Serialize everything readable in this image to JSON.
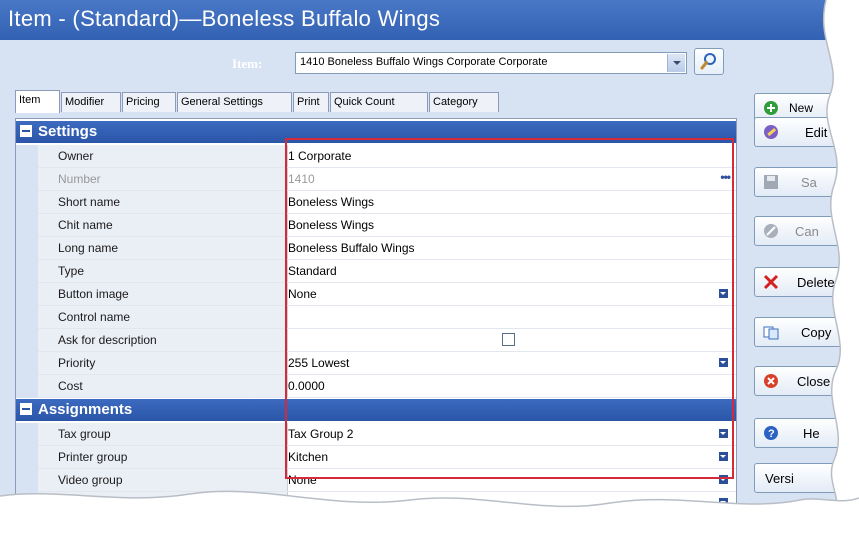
{
  "window": {
    "title": "Item - (Standard)—Boneless Buffalo Wings"
  },
  "item_selector": {
    "label": "Item:",
    "value": "1410 Boneless Buffalo Wings Corporate Corporate"
  },
  "tabs": [
    {
      "label": "Item"
    },
    {
      "label": "Modifier"
    },
    {
      "label": "Pricing"
    },
    {
      "label": "General Settings"
    },
    {
      "label": "Print"
    },
    {
      "label": "Quick Count"
    },
    {
      "label": "Category"
    }
  ],
  "sections": {
    "settings": {
      "title": "Settings"
    },
    "assignments": {
      "title": "Assignments"
    }
  },
  "settings_rows": [
    {
      "name": "Owner",
      "value": "1  Corporate"
    },
    {
      "name": "Number",
      "value": "1410"
    },
    {
      "name": "Short name",
      "value": "Boneless Wings"
    },
    {
      "name": "Chit name",
      "value": "Boneless Wings"
    },
    {
      "name": "Long name",
      "value": "Boneless Buffalo Wings"
    },
    {
      "name": "Type",
      "value": "Standard"
    },
    {
      "name": "Button image",
      "value": "None"
    },
    {
      "name": "Control name",
      "value": ""
    },
    {
      "name": "Ask for description",
      "value": ""
    },
    {
      "name": "Priority",
      "value": "255 Lowest"
    },
    {
      "name": "Cost",
      "value": "0.0000"
    }
  ],
  "assignment_rows": [
    {
      "name": "Tax group",
      "value": "Tax Group 2"
    },
    {
      "name": "Printer group",
      "value": "Kitchen"
    },
    {
      "name": "Video group",
      "value": "None"
    },
    {
      "name": "",
      "value": "None"
    }
  ],
  "buttons": {
    "new": "New",
    "edit": "Edit",
    "save": "Sa",
    "cancel": "Can",
    "delete": "Delete",
    "copy": "Copy",
    "close": "Close",
    "help": "He",
    "version": "Versi"
  }
}
